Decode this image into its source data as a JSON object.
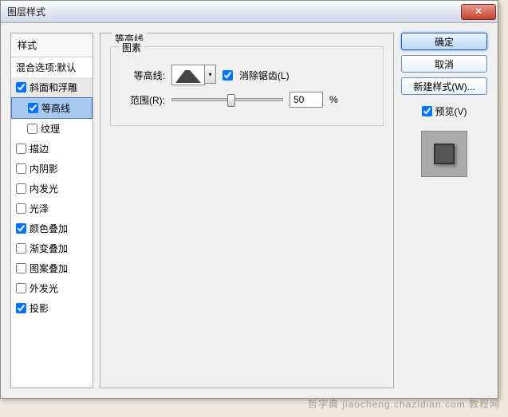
{
  "window": {
    "title": "图层样式"
  },
  "sidebar": {
    "header": "样式",
    "blending": "混合选项:默认",
    "items": [
      {
        "label": "斜面和浮雕",
        "checked": true
      },
      {
        "label": "等高线",
        "checked": true,
        "sub": true,
        "selected": true
      },
      {
        "label": "纹理",
        "checked": false,
        "sub": true
      },
      {
        "label": "描边",
        "checked": false
      },
      {
        "label": "内阴影",
        "checked": false
      },
      {
        "label": "内发光",
        "checked": false
      },
      {
        "label": "光泽",
        "checked": false
      },
      {
        "label": "颜色叠加",
        "checked": true
      },
      {
        "label": "渐变叠加",
        "checked": false
      },
      {
        "label": "图案叠加",
        "checked": false
      },
      {
        "label": "外发光",
        "checked": false
      },
      {
        "label": "投影",
        "checked": true
      }
    ]
  },
  "main": {
    "section": "等高线",
    "group": "图素",
    "contour_label": "等高线:",
    "antialias_label": "消除锯齿(L)",
    "antialias_checked": true,
    "range_label": "范围(R):",
    "range_value": "50",
    "range_unit": "%"
  },
  "right": {
    "ok": "确定",
    "cancel": "取消",
    "new_style": "新建样式(W)...",
    "preview_label": "预览(V)",
    "preview_checked": true
  },
  "watermark": "哲字典 jiaocheng.chazidian.com 教程网"
}
